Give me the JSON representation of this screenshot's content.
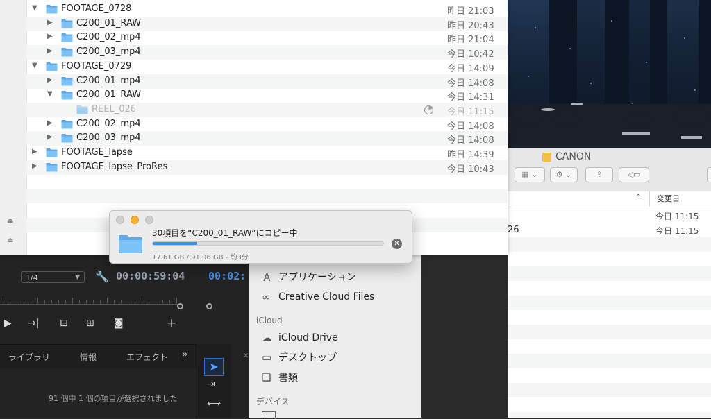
{
  "finder_main": {
    "rows": [
      {
        "name": "FOOTAGE_0728",
        "date": "昨日 21:03",
        "level": 0,
        "expanded": true
      },
      {
        "name": "C200_01_RAW",
        "date": "昨日 20:43",
        "level": 1,
        "expanded": false
      },
      {
        "name": "C200_02_mp4",
        "date": "昨日 21:04",
        "level": 1,
        "expanded": false
      },
      {
        "name": "C200_03_mp4",
        "date": "今日 10:42",
        "level": 1,
        "expanded": false
      },
      {
        "name": "FOOTAGE_0729",
        "date": "今日 14:09",
        "level": 0,
        "expanded": true
      },
      {
        "name": "C200_01_mp4",
        "date": "今日 14:08",
        "level": 1,
        "expanded": false
      },
      {
        "name": "C200_01_RAW",
        "date": "今日 14:31",
        "level": 1,
        "expanded": true
      },
      {
        "name": "REEL_026",
        "date": "今日 11:15",
        "level": 2,
        "copying": true
      },
      {
        "name": "C200_02_mp4",
        "date": "今日 14:08",
        "level": 1,
        "expanded": false
      },
      {
        "name": "C200_03_mp4",
        "date": "今日 14:08",
        "level": 1,
        "expanded": false
      },
      {
        "name": "FOOTAGE_lapse",
        "date": "昨日 14:39",
        "level": 0,
        "expanded": false
      },
      {
        "name": "FOOTAGE_lapse_ProRes",
        "date": "今日 10:43",
        "level": 0,
        "expanded": false
      }
    ]
  },
  "copy_dialog": {
    "title": "30項目を“C200_01_RAW”にコピー中",
    "subtitle": "17.61 GB / 91.06 GB - 約3分",
    "progress": 0.193
  },
  "finder_right": {
    "title": "CANON",
    "date_column": "変更日",
    "rows": [
      {
        "name": "",
        "date": "今日 11:15"
      },
      {
        "name": "26",
        "date": "今日 11:15"
      }
    ]
  },
  "sidebar": {
    "items": [
      {
        "label": "アプリケーション",
        "icon": "applications-icon"
      },
      {
        "label": "Creative Cloud Files",
        "icon": "creative-cloud-icon"
      }
    ],
    "icloud_header": "iCloud",
    "icloud_items": [
      {
        "label": "iCloud Drive",
        "icon": "cloud-icon"
      },
      {
        "label": "デスクトップ",
        "icon": "desktop-icon"
      },
      {
        "label": "書類",
        "icon": "documents-icon"
      }
    ],
    "devices_header": "デバイス"
  },
  "premiere": {
    "zoom": "1/4",
    "source_timecode": "00:00:59:04",
    "program_timecode_partial": "00:02:",
    "tabs": [
      "ライブラリ",
      "情報",
      "エフェクト"
    ],
    "tabs_more": "»",
    "status": "91 個中 1 個の項目が選択されました"
  },
  "colors": {
    "accent": "#3b8cf0",
    "folder": "#5fb0ea",
    "premiere_bg": "#232323"
  }
}
